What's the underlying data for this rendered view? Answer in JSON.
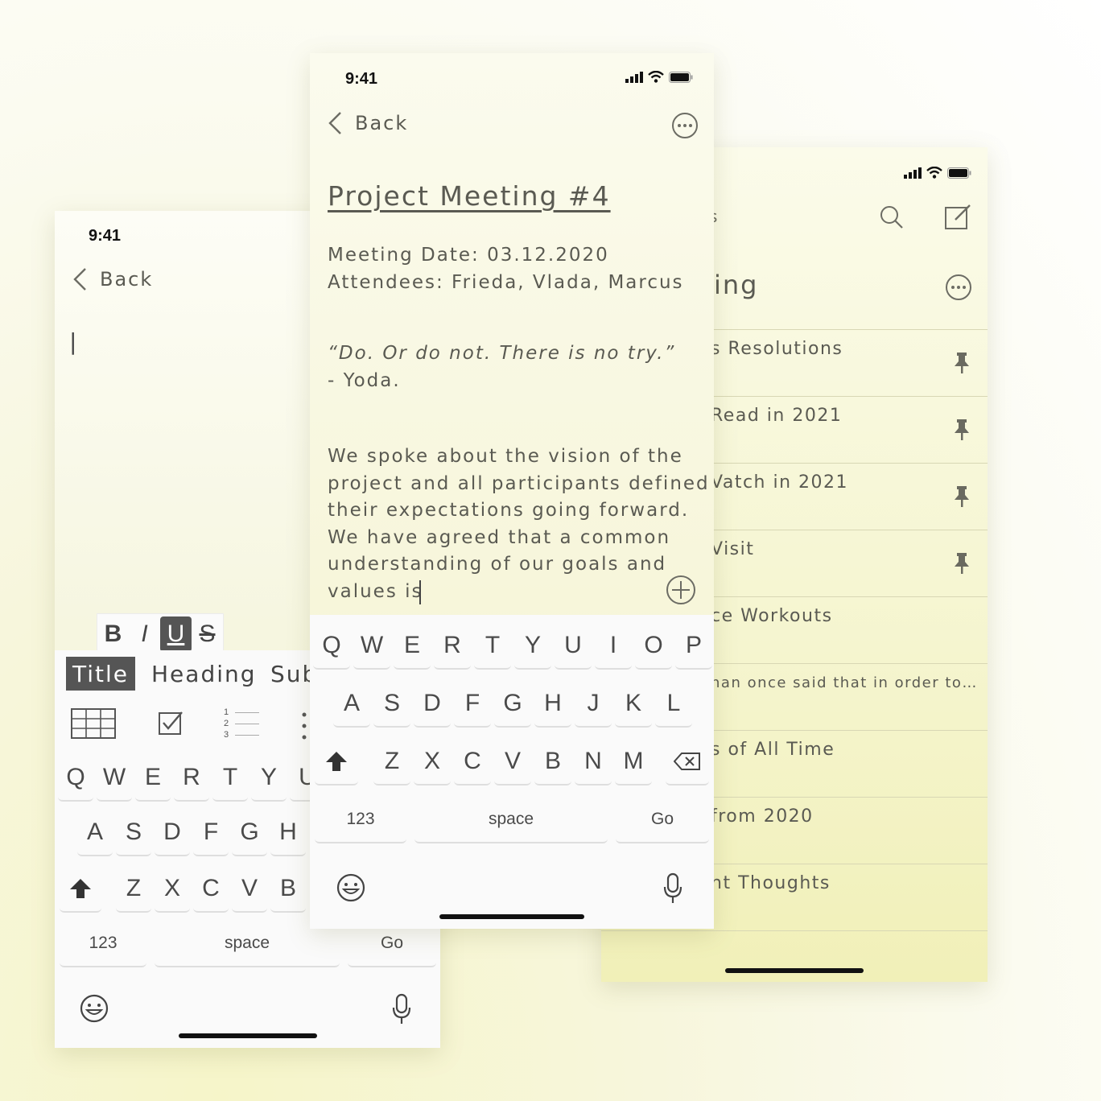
{
  "left_phone": {
    "time": "9:41",
    "back_label": "Back",
    "cursor": "|",
    "format_buttons": [
      "B",
      "I",
      "U",
      "S"
    ],
    "style_options": [
      "Title",
      "Heading",
      "Sub"
    ],
    "numbered_list_digits": [
      "1",
      "2",
      "3"
    ],
    "keyboard": {
      "row1": [
        "Q",
        "W",
        "E",
        "R",
        "T",
        "Y",
        "U"
      ],
      "row2": [
        "A",
        "S",
        "D",
        "F",
        "G",
        "H"
      ],
      "row3": [
        "Z",
        "X",
        "C",
        "V",
        "B"
      ],
      "numbers_key": "123",
      "space_key": "space",
      "go_key": "Go"
    }
  },
  "center_phone": {
    "time": "9:41",
    "back_label": "Back",
    "note_title": "Project Meeting #4",
    "meeting_date": "Meeting Date: 03.12.2020",
    "attendees": "Attendees: Frieda, Vlada, Marcus",
    "quote_line1": "“Do. Or do not. There is no try.”",
    "quote_line2": "- Yoda.",
    "body_lines": [
      "We spoke about the vision of the",
      "project and all participants defined",
      "their expectations going forward.",
      "We have agreed that a common",
      "understanding of our goals and",
      "values is"
    ],
    "keyboard": {
      "row1": [
        "Q",
        "W",
        "E",
        "R",
        "T",
        "Y",
        "U",
        "I",
        "O",
        "P"
      ],
      "row2": [
        "A",
        "S",
        "D",
        "F",
        "G",
        "H",
        "J",
        "K",
        "L"
      ],
      "row3": [
        "Z",
        "X",
        "C",
        "V",
        "B",
        "N",
        "M"
      ],
      "numbers_key": "123",
      "space_key": "space",
      "go_key": "Go"
    }
  },
  "right_phone": {
    "header_fragment": "s",
    "title_fragment": "ing",
    "notes": [
      {
        "label": "s Resolutions",
        "pinned": true
      },
      {
        "label": "Read in 2021",
        "pinned": true
      },
      {
        "label": "Vatch in 2021",
        "pinned": true
      },
      {
        "label": "Visit",
        "pinned": true
      },
      {
        "label": "ce Workouts",
        "pinned": false
      },
      {
        "label": "nan once said that in order to…",
        "pinned": false
      },
      {
        "label": "s of All Time",
        "pinned": false
      },
      {
        "label": "from 2020",
        "pinned": false
      },
      {
        "label": "ht Thoughts",
        "pinned": false
      }
    ]
  },
  "colors": {
    "background": "#f7f6dc",
    "text": "#5a5a52",
    "active_chip": "#555555",
    "keyboard_bg": "#fafafa"
  }
}
